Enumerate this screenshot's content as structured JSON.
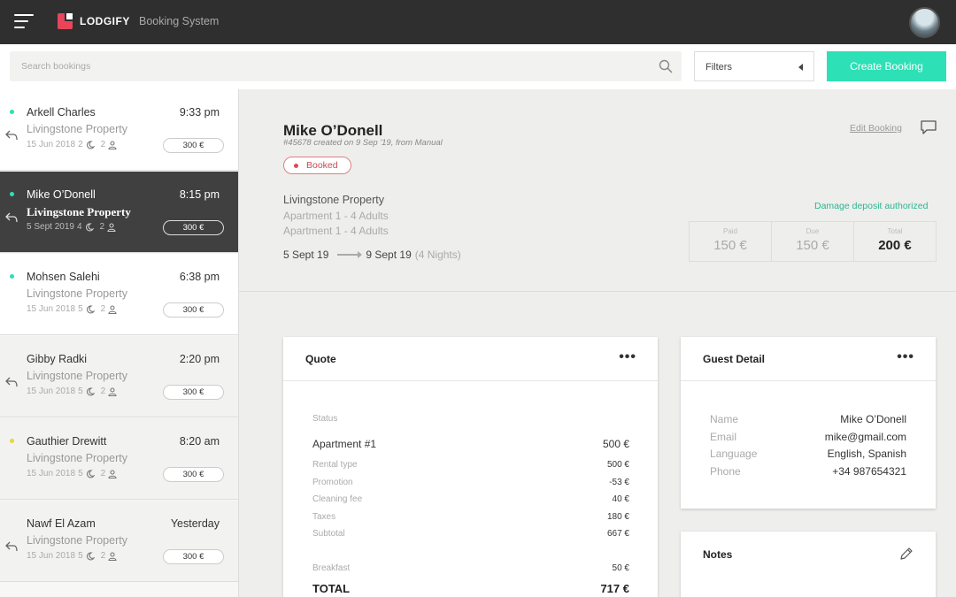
{
  "app": {
    "brand": "LODGIFY",
    "subtitle": "Booking System"
  },
  "search": {
    "placeholder": "Search bookings"
  },
  "filters": {
    "label": "Filters"
  },
  "create_button": "Create Booking",
  "bookings": [
    {
      "name": "Arkell Charles",
      "time": "9:33 pm",
      "property": "Livingstone Property",
      "date": "15 Jun 2018",
      "nights": "2",
      "guests": "2",
      "price": "300 €",
      "dot_color": "#2de0b5"
    },
    {
      "name": "Mike O’Donell",
      "time": "8:15 pm",
      "property": "Livingstone Property",
      "date": "5 Sept 2019",
      "nights": "4",
      "guests": "2",
      "price": "300 €",
      "dot_color": "#2de0b5"
    },
    {
      "name": "Mohsen Salehi",
      "time": "6:38 pm",
      "property": "Livingstone Property",
      "date": "15 Jun 2018",
      "nights": "5",
      "guests": "2",
      "price": "300 €",
      "dot_color": "#2de0b5"
    },
    {
      "name": "Gibby Radki",
      "time": "2:20 pm",
      "property": "Livingstone Property",
      "date": "15 Jun 2018",
      "nights": "5",
      "guests": "2",
      "price": "300 €",
      "dot_color": ""
    },
    {
      "name": "Gauthier Drewitt",
      "time": "8:20 am",
      "property": "Livingstone Property",
      "date": "15 Jun 2018",
      "nights": "5",
      "guests": "2",
      "price": "300 €",
      "dot_color": "#e8d640"
    },
    {
      "name": "Nawf El Azam",
      "time": "Yesterday",
      "property": "Livingstone Property",
      "date": "15 Jun 2018",
      "nights": "5",
      "guests": "2",
      "price": "300 €",
      "dot_color": ""
    }
  ],
  "detail": {
    "guest_name": "Mike O’Donell",
    "sub": "#45678 created on 9 Sep '19, from Manual",
    "status": "Booked",
    "property": "Livingstone Property",
    "apartments": [
      "Apartment 1 - 4 Adults",
      "Apartment 1 - 4 Adults"
    ],
    "date_from": "5 Sept 19",
    "date_to": "9 Sept 19",
    "nights": "(4 Nights)",
    "edit_label": "Edit Booking",
    "damage": "Damage deposit authorized",
    "totals": [
      {
        "label": "Paid",
        "value": "150 €"
      },
      {
        "label": "Due",
        "value": "150 €"
      },
      {
        "label": "Total",
        "value": "200 €"
      }
    ]
  },
  "quote": {
    "title": "Quote",
    "status_label": "Status",
    "lines": [
      {
        "label": "Apartment #1",
        "value": "500 €"
      },
      {
        "label": "Rental type",
        "value": "500 €"
      },
      {
        "label": "Promotion",
        "value": "-53 €"
      },
      {
        "label": "Cleaning fee",
        "value": "40 €"
      },
      {
        "label": "Taxes",
        "value": "180 €"
      },
      {
        "label": "Subtotal",
        "value": "667 €"
      },
      {
        "label": "Breakfast",
        "value": "50 €"
      },
      {
        "label": "TOTAL",
        "value": "717 €"
      }
    ]
  },
  "guest_detail": {
    "title": "Guest Detail",
    "rows": [
      {
        "key": "Name",
        "value": "Mike O’Donell"
      },
      {
        "key": "Email",
        "value": "mike@gmail.com"
      },
      {
        "key": "Language",
        "value": "English, Spanish"
      },
      {
        "key": "Phone",
        "value": "+34 987654321"
      }
    ]
  },
  "notes": {
    "title": "Notes"
  }
}
